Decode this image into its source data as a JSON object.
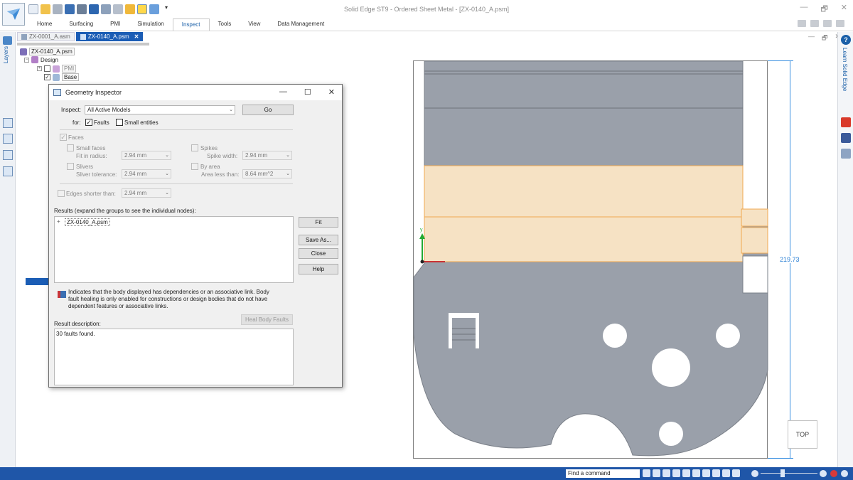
{
  "window": {
    "title": "Solid Edge ST9 - Ordered Sheet Metal - [ZX-0140_A.psm]",
    "controls": [
      "—",
      "🗗",
      "✕"
    ]
  },
  "ribbon": {
    "tabs": [
      "Home",
      "Surfacing",
      "PMI",
      "Simulation",
      "Inspect",
      "Tools",
      "View",
      "Data Management"
    ],
    "active_tab": "Inspect"
  },
  "doc_tabs": [
    {
      "label": "ZX-0001_A.asm",
      "active": false
    },
    {
      "label": "ZX-0140_A.psm",
      "active": true
    }
  ],
  "doc_controls": [
    "—",
    "🗗",
    "✕"
  ],
  "left_panel": {
    "layers_label": "Layers"
  },
  "right_panel": {
    "help": "?",
    "learn_label": "Learn Solid Edge"
  },
  "tree": {
    "root": "ZX-0140_A.psm",
    "design": "Design",
    "pmi": "PMI",
    "base": "Base"
  },
  "dialog": {
    "title": "Geometry Inspector",
    "controls": [
      "—",
      "☐",
      "✕"
    ],
    "inspect_label": "Inspect:",
    "inspect_value": "All Active Models",
    "go_label": "Go",
    "for_label": "for:",
    "faults_label": "Faults",
    "faults_checked": "✓",
    "small_entities_label": "Small entities",
    "faces_label": "Faces",
    "faces_checked": "✓",
    "small_faces_label": "Small faces",
    "fit_in_radius_label": "Fit in radius:",
    "fit_in_radius_value": "2.94 mm",
    "spikes_label": "Spikes",
    "spike_width_label": "Spike width:",
    "spike_width_value": "2.94 mm",
    "slivers_label": "Slivers",
    "sliver_tolerance_label": "Sliver tolerance:",
    "sliver_tolerance_value": "2.94 mm",
    "by_area_label": "By area",
    "area_less_than_label": "Area less than:",
    "area_less_than_value": "8.64 mm^2",
    "edges_shorter_label": "Edges shorter than:",
    "edges_shorter_value": "2.94 mm",
    "results_label": "Results (expand the groups to see the individual nodes):",
    "result_node": "ZX-0140_A.psm",
    "result_expander": "+",
    "fit_label": "Fit",
    "save_as_label": "Save As...",
    "close_label": "Close",
    "help_label": "Help",
    "info_text": "Indicates that the body displayed has dependencies or an associative link. Body fault healing is only enabled for constructions or design bodies that do not have dependent features or associative links.",
    "heal_label": "Heal Body Faults",
    "result_description_label": "Result description:",
    "result_description_value": "30 faults found."
  },
  "drawing": {
    "dimension": "219.73",
    "view_label": "TOP",
    "axis_y_label": "y"
  },
  "statusbar": {
    "find_command": "Find a command"
  },
  "colors": {
    "accent": "#1b5db5",
    "part": "#9aa0aa",
    "highlight": "#f6e2c4",
    "highlight_edge": "#f0a850",
    "dimension": "#3a8fe0"
  }
}
